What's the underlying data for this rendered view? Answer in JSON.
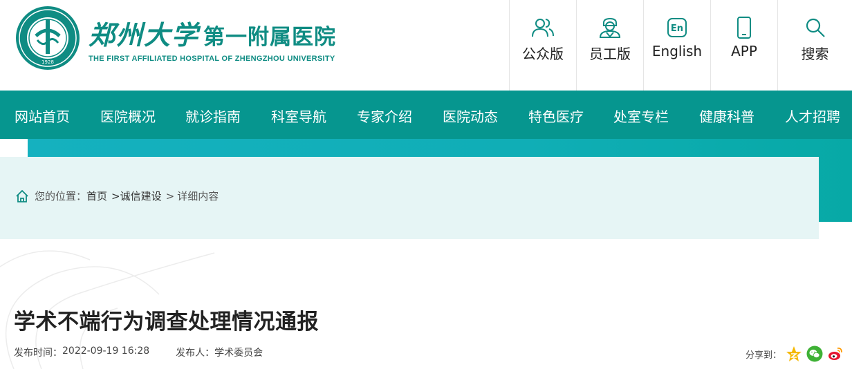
{
  "header": {
    "logo_cn_calligraphy": "郑州大学",
    "logo_cn_plain": "第一附属医院",
    "logo_en": "THE FIRST AFFILIATED HOSPITAL OF ZHENGZHOU UNIVERSITY",
    "seal_year": "1928",
    "quick_links": [
      {
        "label": "公众版",
        "icon": "public-users-icon"
      },
      {
        "label": "员工版",
        "icon": "staff-icon"
      },
      {
        "label": "English",
        "icon": "english-icon",
        "badge": "En"
      },
      {
        "label": "APP",
        "icon": "mobile-phone-icon"
      },
      {
        "label": "搜索",
        "icon": "search-icon"
      }
    ]
  },
  "nav": {
    "items": [
      "网站首页",
      "医院概况",
      "就诊指南",
      "科室导航",
      "专家介绍",
      "医院动态",
      "特色医疗",
      "处室专栏",
      "健康科普",
      "人才招聘"
    ]
  },
  "breadcrumb": {
    "prefix": "您的位置：",
    "home": "首页",
    "section": ">诚信建设",
    "sep": ">",
    "current": "详细内容"
  },
  "article": {
    "title": "学术不端行为调查处理情况通报",
    "publish_time_label": "发布时间：",
    "publish_time": "2022-09-19 16:28",
    "publisher_label": "发布人：",
    "publisher": "学术委员会"
  },
  "share": {
    "label": "分享到：",
    "targets": [
      "qzone-icon",
      "wechat-icon",
      "weibo-icon"
    ]
  },
  "colors": {
    "brand": "#0f8c83",
    "nav_bg": "#06968f",
    "band": "#10aeb6",
    "crumb_bg": "#e6f5f5"
  }
}
